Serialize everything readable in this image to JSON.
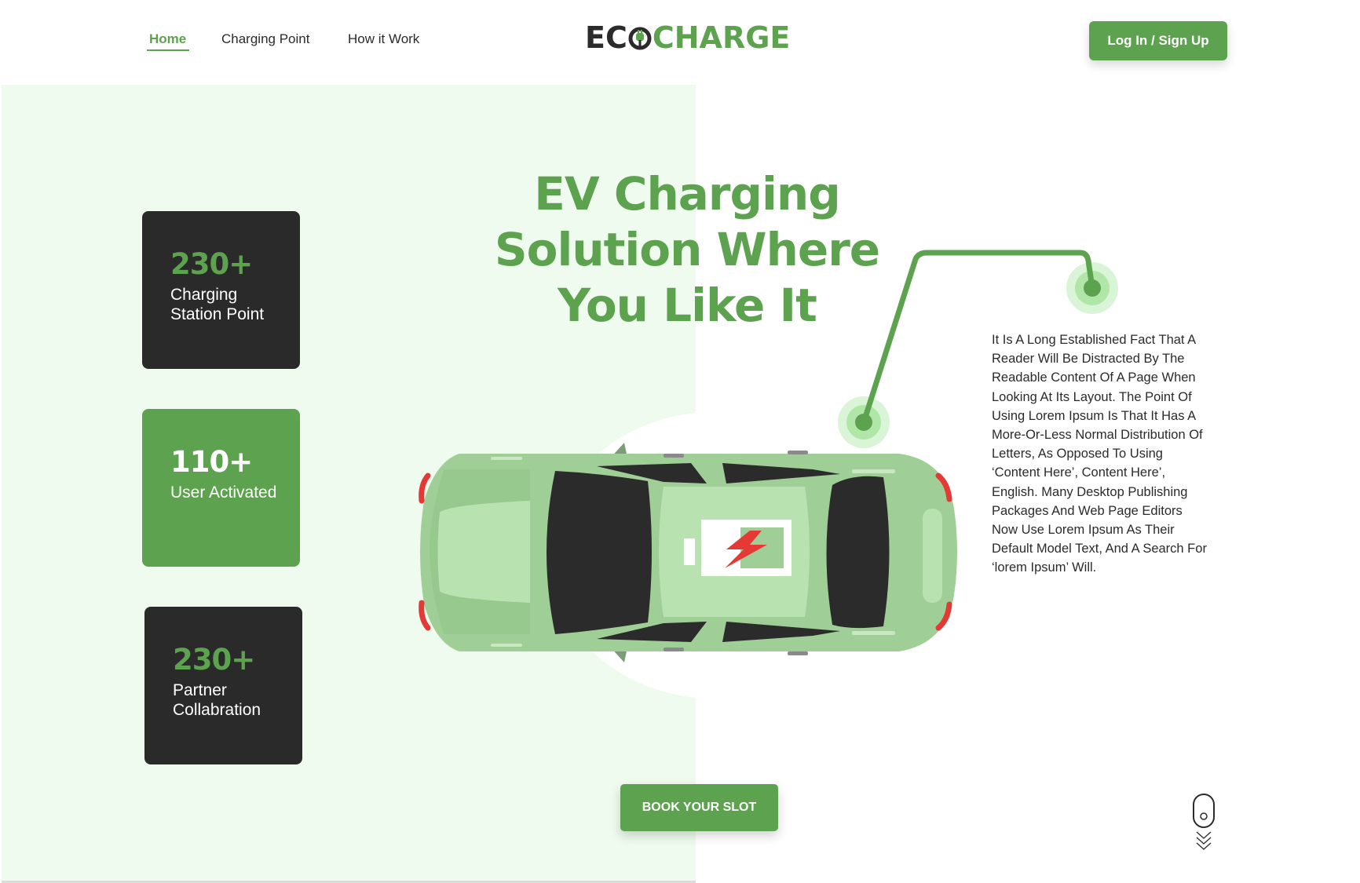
{
  "nav": {
    "links": [
      "Home",
      "Charging Point",
      "How it Work"
    ],
    "active": "Home",
    "login_label": "Log In / Sign Up"
  },
  "logo": {
    "part1": "EC",
    "part2": "CHARGE"
  },
  "stats": [
    {
      "value": "230+",
      "label": "Charging Station Point",
      "style": "dark"
    },
    {
      "value": "110+",
      "label": "User Activated",
      "style": "green"
    },
    {
      "value": "230+",
      "label": "Partner Collabration",
      "style": "dark"
    }
  ],
  "hero": {
    "headline": "EV Charging Solution Where You Like It",
    "description": "It Is A Long Established Fact That A Reader Will Be Distracted By The Readable Content Of A Page When Looking At Its Layout. The Point Of Using Lorem Ipsum Is That It Has A More-Or-Less Normal Distribution Of Letters, As Opposed To Using ‘Content Here’, Content Here’, English. Many Desktop Publishing Packages And Web Page Editors Now Use Lorem Ipsum As Their Default Model Text, And A Search For ‘lorem Ipsum’ Will.",
    "cta_label": "BOOK YOUR SLOT"
  },
  "icons": {
    "logo_plug": "plug-icon",
    "car": "electric-car-illustration",
    "battery": "battery-charging-icon",
    "scroll": "scroll-down-mouse-icon"
  },
  "colors": {
    "accent": "#5da24e",
    "dark": "#2a2a2a",
    "hero_bg": "#effbee",
    "car_body": "#9fcf96"
  }
}
